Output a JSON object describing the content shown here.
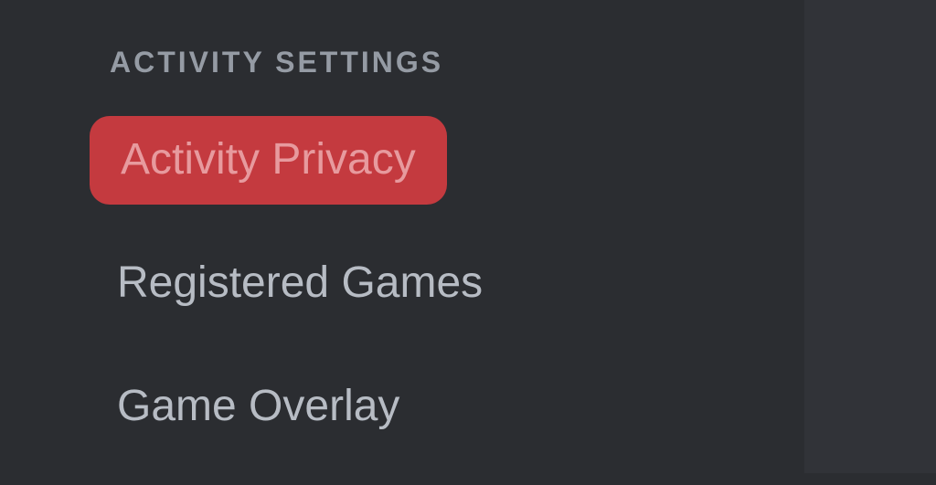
{
  "sidebar": {
    "section_header": "ACTIVITY SETTINGS",
    "items": [
      {
        "label": "Activity Privacy",
        "highlighted": true
      },
      {
        "label": "Registered Games",
        "highlighted": false
      },
      {
        "label": "Game Overlay",
        "highlighted": false
      }
    ]
  }
}
